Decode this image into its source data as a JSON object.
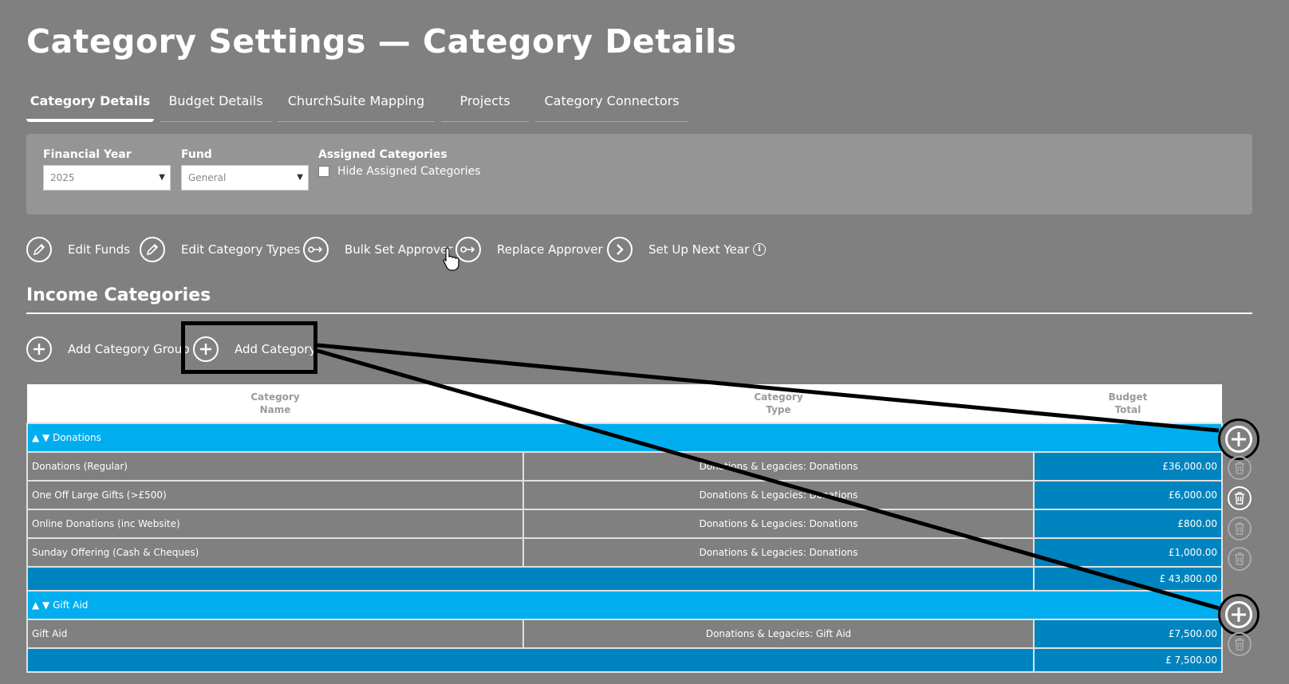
{
  "page_title": "Category Settings — Category Details",
  "tabs": [
    {
      "label": "Category Details"
    },
    {
      "label": "Budget Details"
    },
    {
      "label": "ChurchSuite Mapping"
    },
    {
      "label": "Projects"
    },
    {
      "label": "Category Connectors"
    }
  ],
  "filters": {
    "financial_year": {
      "label": "Financial Year",
      "value": "2025"
    },
    "fund": {
      "label": "Fund",
      "value": "General"
    },
    "assigned": {
      "label": "Assigned Categories",
      "checkbox_label": "Hide Assigned Categories",
      "checked": false
    }
  },
  "actions": {
    "edit_funds": "Edit Funds",
    "edit_category_types": "Edit Category Types",
    "bulk_set_approver": "Bulk Set Approver",
    "replace_approver": "Replace Approver",
    "set_up_next_year": "Set Up Next Year"
  },
  "income": {
    "title": "Income Categories",
    "add_group": "Add Category Group",
    "add_category": "Add Category",
    "columns": {
      "name_1": "Category",
      "name_2": "Name",
      "type_1": "Category",
      "type_2": "Type",
      "budget_1": "Budget",
      "budget_2": "Total"
    },
    "groups": [
      {
        "name": "▲ ▼ Donations",
        "rows": [
          {
            "name": "Donations (Regular)",
            "type": "Donations & Legacies: Donations",
            "budget": "£36,000.00"
          },
          {
            "name": "One Off Large Gifts (>£500)",
            "type": "Donations & Legacies: Donations",
            "budget": "£6,000.00"
          },
          {
            "name": "Online Donations (inc Website)",
            "type": "Donations & Legacies: Donations",
            "budget": "£800.00"
          },
          {
            "name": "Sunday Offering (Cash & Cheques)",
            "type": "Donations & Legacies: Donations",
            "budget": "£1,000.00"
          }
        ],
        "total": "£ 43,800.00"
      },
      {
        "name": "▲ ▼ Gift Aid",
        "rows": [
          {
            "name": "Gift Aid",
            "type": "Donations & Legacies: Gift Aid",
            "budget": "£7,500.00"
          }
        ],
        "total": "£ 7,500.00"
      }
    ]
  },
  "colors": {
    "background": "#808080",
    "group_row": "#00aeef",
    "budget_cell": "#0084bf",
    "annotation": "#000000"
  },
  "icons": [
    "pencil-icon",
    "key-icon",
    "chevron-right-icon",
    "info-icon",
    "plus-icon",
    "trash-icon",
    "hand-cursor-icon"
  ]
}
